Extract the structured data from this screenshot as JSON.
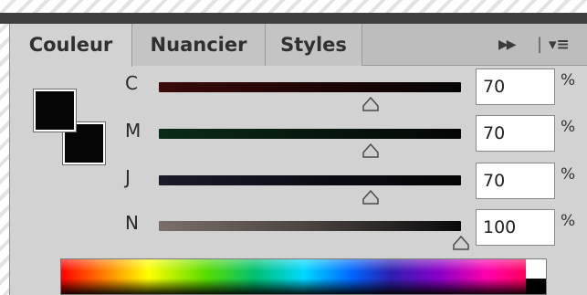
{
  "panel": {
    "tabs": [
      {
        "label": "Couleur",
        "active": true
      },
      {
        "label": "Nuancier",
        "active": false
      },
      {
        "label": "Styles",
        "active": false
      }
    ],
    "forward_icon": "double-right-arrow-icon",
    "menu_icon": "panel-menu-icon"
  },
  "swatches": {
    "foreground_color": "#050505",
    "background_color": "#050505"
  },
  "sliders": [
    {
      "label": "C",
      "value": "70",
      "unit": "%",
      "level": 0.7
    },
    {
      "label": "M",
      "value": "70",
      "unit": "%",
      "level": 0.7
    },
    {
      "label": "J",
      "value": "70",
      "unit": "%",
      "level": 0.7
    },
    {
      "label": "N",
      "value": "100",
      "unit": "%",
      "level": 1.0
    }
  ],
  "spectrum": {
    "type": "cmyk-spectrum-ramp"
  }
}
